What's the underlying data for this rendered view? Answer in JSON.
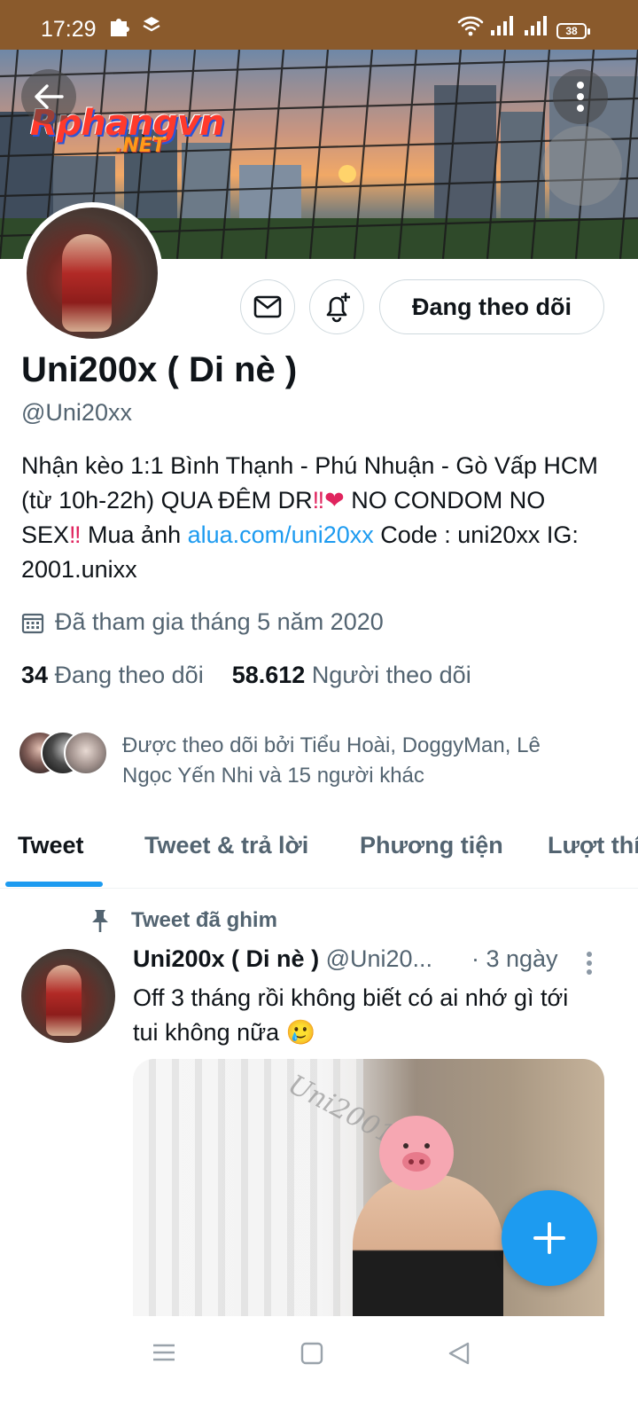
{
  "status_bar": {
    "time": "17:29",
    "battery": "38"
  },
  "banner": {
    "watermark": "Rphangvn",
    "watermark_sub": ".NET"
  },
  "profile": {
    "display_name": "Uni200x ( Di nè )",
    "handle": "@Uni20xx",
    "follow_button": "Đang theo dõi",
    "bio_text_1": "Nhận kèo 1:1 Bình Thạnh - Phú Nhuận - Gò Vấp HCM (từ 10h-22h) QUA ĐÊM DR",
    "bio_text_2": " NO CONDOM NO SEX",
    "bio_text_3": " Mua ảnh ",
    "bio_link": "alua.com/uni20xx",
    "bio_text_4": " Code : uni20xx IG: 2001.unixx",
    "joined": "Đã tham gia tháng 5 năm 2020",
    "following_count": "34",
    "following_label": "Đang theo dõi",
    "followers_count": "58.612",
    "followers_label": "Người theo dõi",
    "followed_by": "Được theo dõi bởi Tiểu Hoài, DoggyMan, Lê Ngọc Yến Nhi và 15 người khác"
  },
  "tabs": [
    {
      "label": "Tweet"
    },
    {
      "label": "Tweet & trả lời"
    },
    {
      "label": "Phương tiện"
    },
    {
      "label": "Lượt thích"
    }
  ],
  "pinned_tweet": {
    "pinned_label": "Tweet đã ghim",
    "name": "Uni200x ( Di nè )",
    "handle": "@Uni20...",
    "time": "· 3 ngày",
    "text": "Off 3 tháng rồi không biết có ai nhớ gì tới tui không nữa 🥲",
    "media_watermark": "Uni2001"
  },
  "colors": {
    "accent": "#1d9bf0",
    "status_bar": "#8a5a2c",
    "muted_text": "#536471"
  }
}
